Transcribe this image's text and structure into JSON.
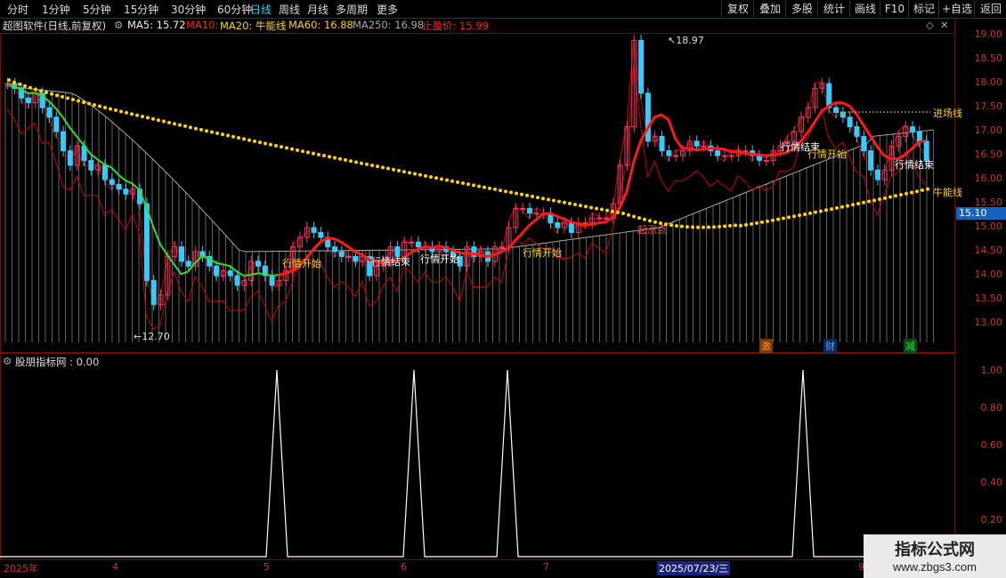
{
  "toolbar": {
    "tabs": [
      "分时",
      "1分钟",
      "5分钟",
      "15分钟",
      "30分钟",
      "60分钟",
      "日线",
      "周线",
      "月线",
      "多周期",
      "更多"
    ],
    "active_tab": "日线",
    "right_buttons": [
      "复权",
      "叠加",
      "多股",
      "统计",
      "画线",
      "F10",
      "标记",
      "+自选",
      "返回"
    ]
  },
  "main_legend": {
    "title": "超图软件(日线,前复权)",
    "ma5": "MA5: 15.72",
    "ma10": "MA10:",
    "ma20": "MA20: 牛能线",
    "ma60": "MA60: 16.88",
    "ma250": "MA250: 16.98",
    "stop": "止盈价: 15.99"
  },
  "price_axis": [
    "19.00",
    "18.50",
    "18.00",
    "17.50",
    "17.00",
    "16.50",
    "16.00",
    "15.50",
    "15.00",
    "14.50",
    "14.00",
    "13.50",
    "13.00"
  ],
  "current_price": "15.10",
  "annotations": {
    "high": "18.97",
    "low": "12.70",
    "signal_start": "行情开始",
    "signal_end": "行情结束",
    "entry": "进场线",
    "bull_line": "牛能线",
    "breakout": "起涨点",
    "tags": [
      "激",
      "财",
      "减"
    ]
  },
  "indicator": {
    "title": "股朋指标网 : 0.00",
    "axis": [
      "1.00",
      "0.80",
      "0.60",
      "0.40",
      "0.20"
    ]
  },
  "date_axis": [
    "2025年",
    "4",
    "5",
    "6",
    "7",
    "2025/07/23/三",
    "9"
  ],
  "watermark": {
    "line1": "指标公式网",
    "line2": "www.zbgs3.com"
  },
  "colors": {
    "up": "#ff3366",
    "down": "#33ccff",
    "ma_bull": "#ffd400",
    "ma_red": "#ff2222",
    "ma_green": "#33dd33",
    "border": "#8b0000"
  }
}
